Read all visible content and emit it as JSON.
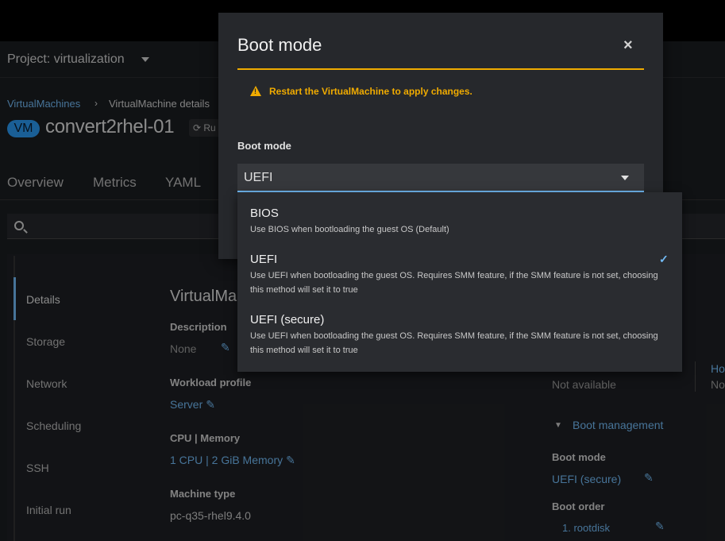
{
  "project": {
    "label": "Project: virtualization"
  },
  "breadcrumb": {
    "parent": "VirtualMachines",
    "separator": "›",
    "current": "VirtualMachine details"
  },
  "vm": {
    "badge": "VM",
    "name": "convert2rhel-01",
    "status": "Ru"
  },
  "tabs": [
    "Overview",
    "Metrics",
    "YAML"
  ],
  "sidenav": [
    "Details",
    "Storage",
    "Network",
    "Scheduling",
    "SSH",
    "Initial run"
  ],
  "details": {
    "section_title": "VirtualMa",
    "description_label": "Description",
    "description_value": "None",
    "workload_label": "Workload profile",
    "workload_value": "Server",
    "cpu_label": "CPU | Memory",
    "cpu_value": "1 CPU | 2 GiB Memory",
    "machine_label": "Machine type",
    "machine_value": "pc-q35-rhel9.4.0"
  },
  "right": {
    "not_available": "Not available",
    "ho": "Ho",
    "no": "No",
    "boot_management": "Boot management",
    "boot_mode_label": "Boot mode",
    "boot_mode_value": "UEFI (secure)",
    "boot_order_label": "Boot order",
    "boot_order_value": "1. rootdisk"
  },
  "modal": {
    "title": "Boot mode",
    "close": "×",
    "alert": "Restart the VirtualMachine to apply changes.",
    "field_label": "Boot mode",
    "selected": "UEFI"
  },
  "options": [
    {
      "title": "BIOS",
      "description": "Use BIOS when bootloading the guest OS (Default)"
    },
    {
      "title": "UEFI",
      "description": "Use UEFI when bootloading the guest OS. Requires SMM feature, if the SMM feature is not set, choosing this method will set it to true",
      "selected": true
    },
    {
      "title": "UEFI (secure)",
      "description": "Use UEFI when bootloading the guest OS. Requires SMM feature, if the SMM feature is not set, choosing this method will set it to true"
    }
  ],
  "colors": {
    "accent": "#73bcf7",
    "warning": "#f0ab00",
    "badge": "#2b9af3"
  }
}
